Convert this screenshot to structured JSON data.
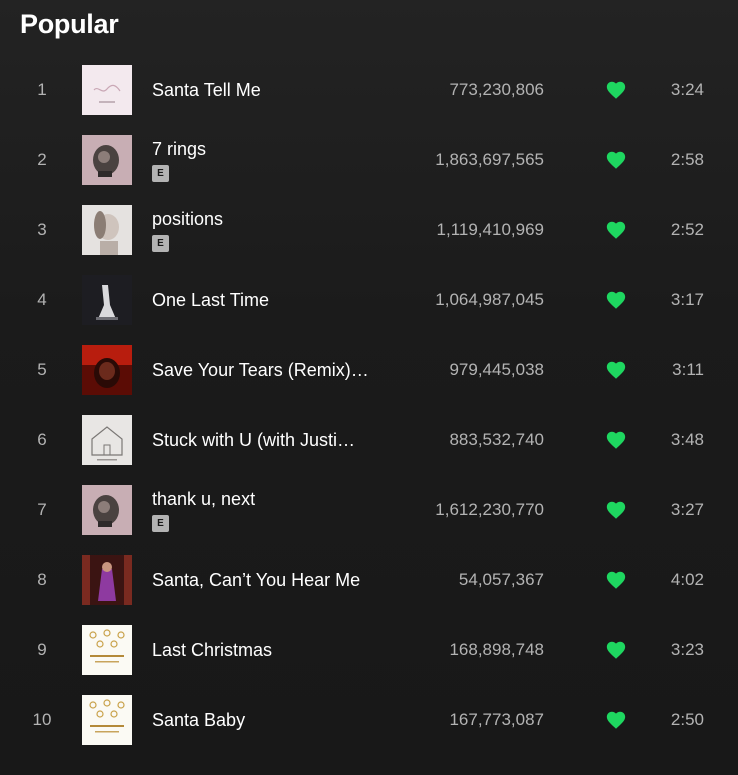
{
  "section": {
    "title": "Popular"
  },
  "colors": {
    "accent": "#1ed760",
    "text_secondary": "#b3b3b3"
  },
  "tracks": [
    {
      "num": "1",
      "title": "Santa Tell Me",
      "explicit": false,
      "plays": "773,230,806",
      "duration": "3:24",
      "liked": true,
      "cover": "santa-tell-me"
    },
    {
      "num": "2",
      "title": "7 rings",
      "explicit": true,
      "explicit_label": "E",
      "plays": "1,863,697,565",
      "duration": "2:58",
      "liked": true,
      "cover": "thank-u-next"
    },
    {
      "num": "3",
      "title": "positions",
      "explicit": true,
      "explicit_label": "E",
      "plays": "1,119,410,969",
      "duration": "2:52",
      "liked": true,
      "cover": "positions"
    },
    {
      "num": "4",
      "title": "One Last Time",
      "explicit": false,
      "plays": "1,064,987,045",
      "duration": "3:17",
      "liked": true,
      "cover": "my-everything"
    },
    {
      "num": "5",
      "title": "Save Your Tears (Remix)…",
      "explicit": false,
      "plays": "979,445,038",
      "duration": "3:11",
      "liked": true,
      "cover": "save-your-tears"
    },
    {
      "num": "6",
      "title": "Stuck with U (with Justi…",
      "explicit": false,
      "plays": "883,532,740",
      "duration": "3:48",
      "liked": true,
      "cover": "stuck-with-u"
    },
    {
      "num": "7",
      "title": "thank u, next",
      "explicit": true,
      "explicit_label": "E",
      "plays": "1,612,230,770",
      "duration": "3:27",
      "liked": true,
      "cover": "thank-u-next"
    },
    {
      "num": "8",
      "title": "Santa, Can’t You Hear Me",
      "explicit": false,
      "plays": "54,057,367",
      "duration": "4:02",
      "liked": true,
      "cover": "santa-cant-you-hear-me"
    },
    {
      "num": "9",
      "title": "Last Christmas",
      "explicit": false,
      "plays": "168,898,748",
      "duration": "3:23",
      "liked": true,
      "cover": "christmas-kisses"
    },
    {
      "num": "10",
      "title": "Santa Baby",
      "explicit": false,
      "plays": "167,773,087",
      "duration": "2:50",
      "liked": true,
      "cover": "christmas-kisses"
    }
  ]
}
